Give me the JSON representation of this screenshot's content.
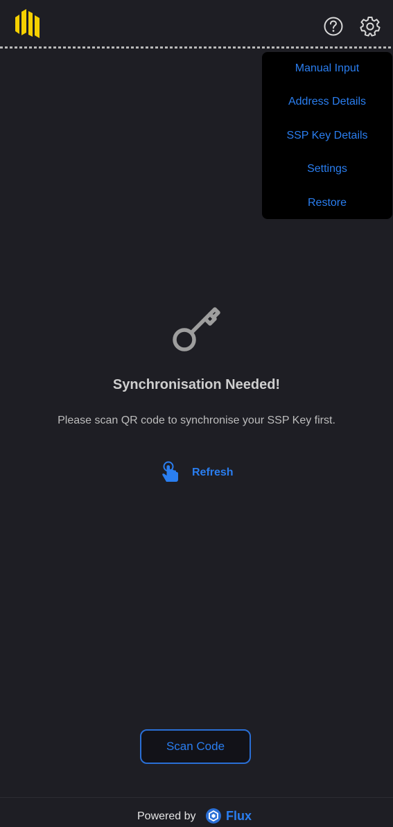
{
  "header": {
    "logo_icon": "ssp-wallet-logo-icon",
    "help_icon": "question-circle-icon",
    "settings_icon": "gear-icon"
  },
  "menu": {
    "items": [
      {
        "label": "Manual Input"
      },
      {
        "label": "Address Details"
      },
      {
        "label": "SSP Key Details"
      },
      {
        "label": "Settings"
      },
      {
        "label": "Restore"
      }
    ]
  },
  "main": {
    "icon": "key-icon",
    "title": "Synchronisation Needed!",
    "subtitle": "Please scan QR code to synchronise your SSP Key first.",
    "refresh_icon": "tap-hand-icon",
    "refresh_label": "Refresh"
  },
  "actions": {
    "scan_label": "Scan Code"
  },
  "footer": {
    "powered_label": "Powered by",
    "brand_icon": "flux-logo-icon",
    "brand_name": "Flux"
  },
  "colors": {
    "background": "#1e1e24",
    "accent": "#2a7ef0",
    "logo_yellow": "#f5d000",
    "menu_background": "#000000"
  }
}
